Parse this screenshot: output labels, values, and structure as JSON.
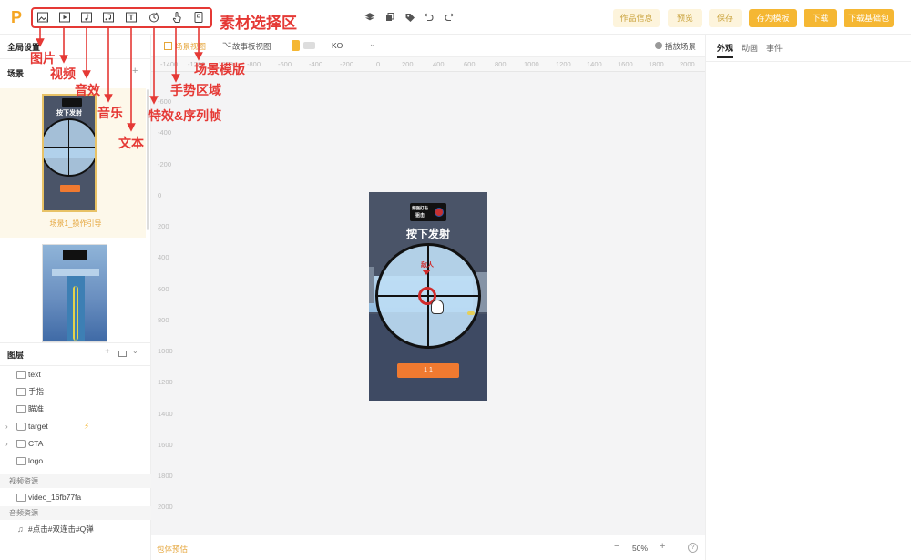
{
  "toolbar": {
    "asset_icons": [
      "image-icon",
      "video-icon",
      "sound-effect-icon",
      "music-icon",
      "text-icon",
      "effect-icon",
      "gesture-icon",
      "scene-template-icon"
    ],
    "buttons": {
      "info": "作品信息",
      "preview": "预览",
      "save": "保存",
      "save_template": "存为模板",
      "download": "下载",
      "download_base": "下载基础包"
    }
  },
  "annotations": {
    "title": "素材选择区",
    "image": "图片",
    "video": "视频",
    "sound": "音效",
    "music": "音乐",
    "text": "文本",
    "effect": "特效&序列帧",
    "gesture": "手势区域",
    "template": "场景模版"
  },
  "left": {
    "global_settings": "全局设置",
    "scenes_label": "场景",
    "scene1_name": "场景1_操作引导",
    "layers_label": "图层",
    "layers": [
      {
        "icon": "text-layer-icon",
        "label": "text",
        "folder": false
      },
      {
        "icon": "image-layer-icon",
        "label": "手指",
        "folder": false
      },
      {
        "icon": "image-layer-icon",
        "label": "瞄准",
        "folder": false
      },
      {
        "icon": "folder-icon",
        "label": "target",
        "folder": true
      },
      {
        "icon": "folder-icon",
        "label": "CTA",
        "folder": true
      },
      {
        "icon": "image-layer-icon",
        "label": "logo",
        "folder": false
      }
    ],
    "video_res_label": "视频资源",
    "video_item": "video_16fb77fa",
    "audio_res_label": "音频资源",
    "audio_item": "#点击#双连击#Q弹"
  },
  "subbar": {
    "scene_view": "场景视图",
    "storyboard_view": "故事板视图",
    "lang": "KO",
    "play_scene": "播放场景"
  },
  "ruler_x": [
    "-1400",
    "-1200",
    "-1000",
    "-800",
    "-600",
    "-400",
    "-200",
    "0",
    "200",
    "400",
    "600",
    "800",
    "1000",
    "1200",
    "1400",
    "1600",
    "1800",
    "2000"
  ],
  "ruler_y": [
    "-600",
    "-400",
    "-200",
    "0",
    "200",
    "400",
    "600",
    "800",
    "1000",
    "1200",
    "1400",
    "1600",
    "1800",
    "2000"
  ],
  "phone": {
    "logo_line1": "超强打击",
    "logo_line2": "狙击",
    "headline": "按下发射",
    "enemy": "敌人",
    "cta": "1 1"
  },
  "bottom": {
    "package_estimate": "包体预估",
    "minus": "−",
    "zoom": "50%",
    "plus": "+",
    "help": "?"
  },
  "right": {
    "tabs": [
      "外观",
      "动画",
      "事件"
    ]
  },
  "colors": {
    "accent": "#f5b733",
    "accent_light": "#fdf4dc",
    "annotation_red": "#e53935",
    "cta_orange": "#f07a30"
  }
}
